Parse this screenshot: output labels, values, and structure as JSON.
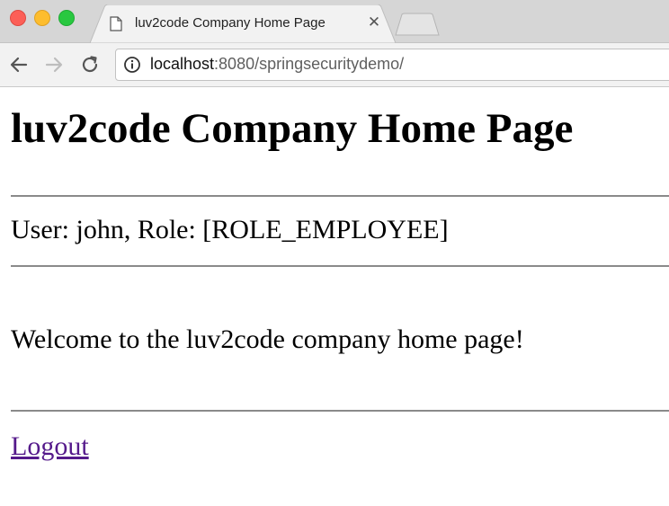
{
  "browser": {
    "tab": {
      "title": "luv2code Company Home Page",
      "close_glyph": "✕"
    },
    "address_bar": {
      "host": "localhost",
      "rest": ":8080/springsecuritydemo/"
    },
    "icons": [
      "back-arrow-icon",
      "forward-arrow-icon",
      "reload-icon",
      "info-icon",
      "page-icon",
      "close-icon",
      "new-tab-icon"
    ]
  },
  "page": {
    "heading": "luv2code Company Home Page",
    "user_line": "User: john, Role: [ROLE_EMPLOYEE]",
    "welcome": "Welcome to the luv2code company home page!",
    "logout_label": "Logout"
  },
  "colors": {
    "link_visited": "#551a8b",
    "close_light": "#fc5f57",
    "minimize_light": "#fdbd2e",
    "zoom_light": "#29c840"
  }
}
